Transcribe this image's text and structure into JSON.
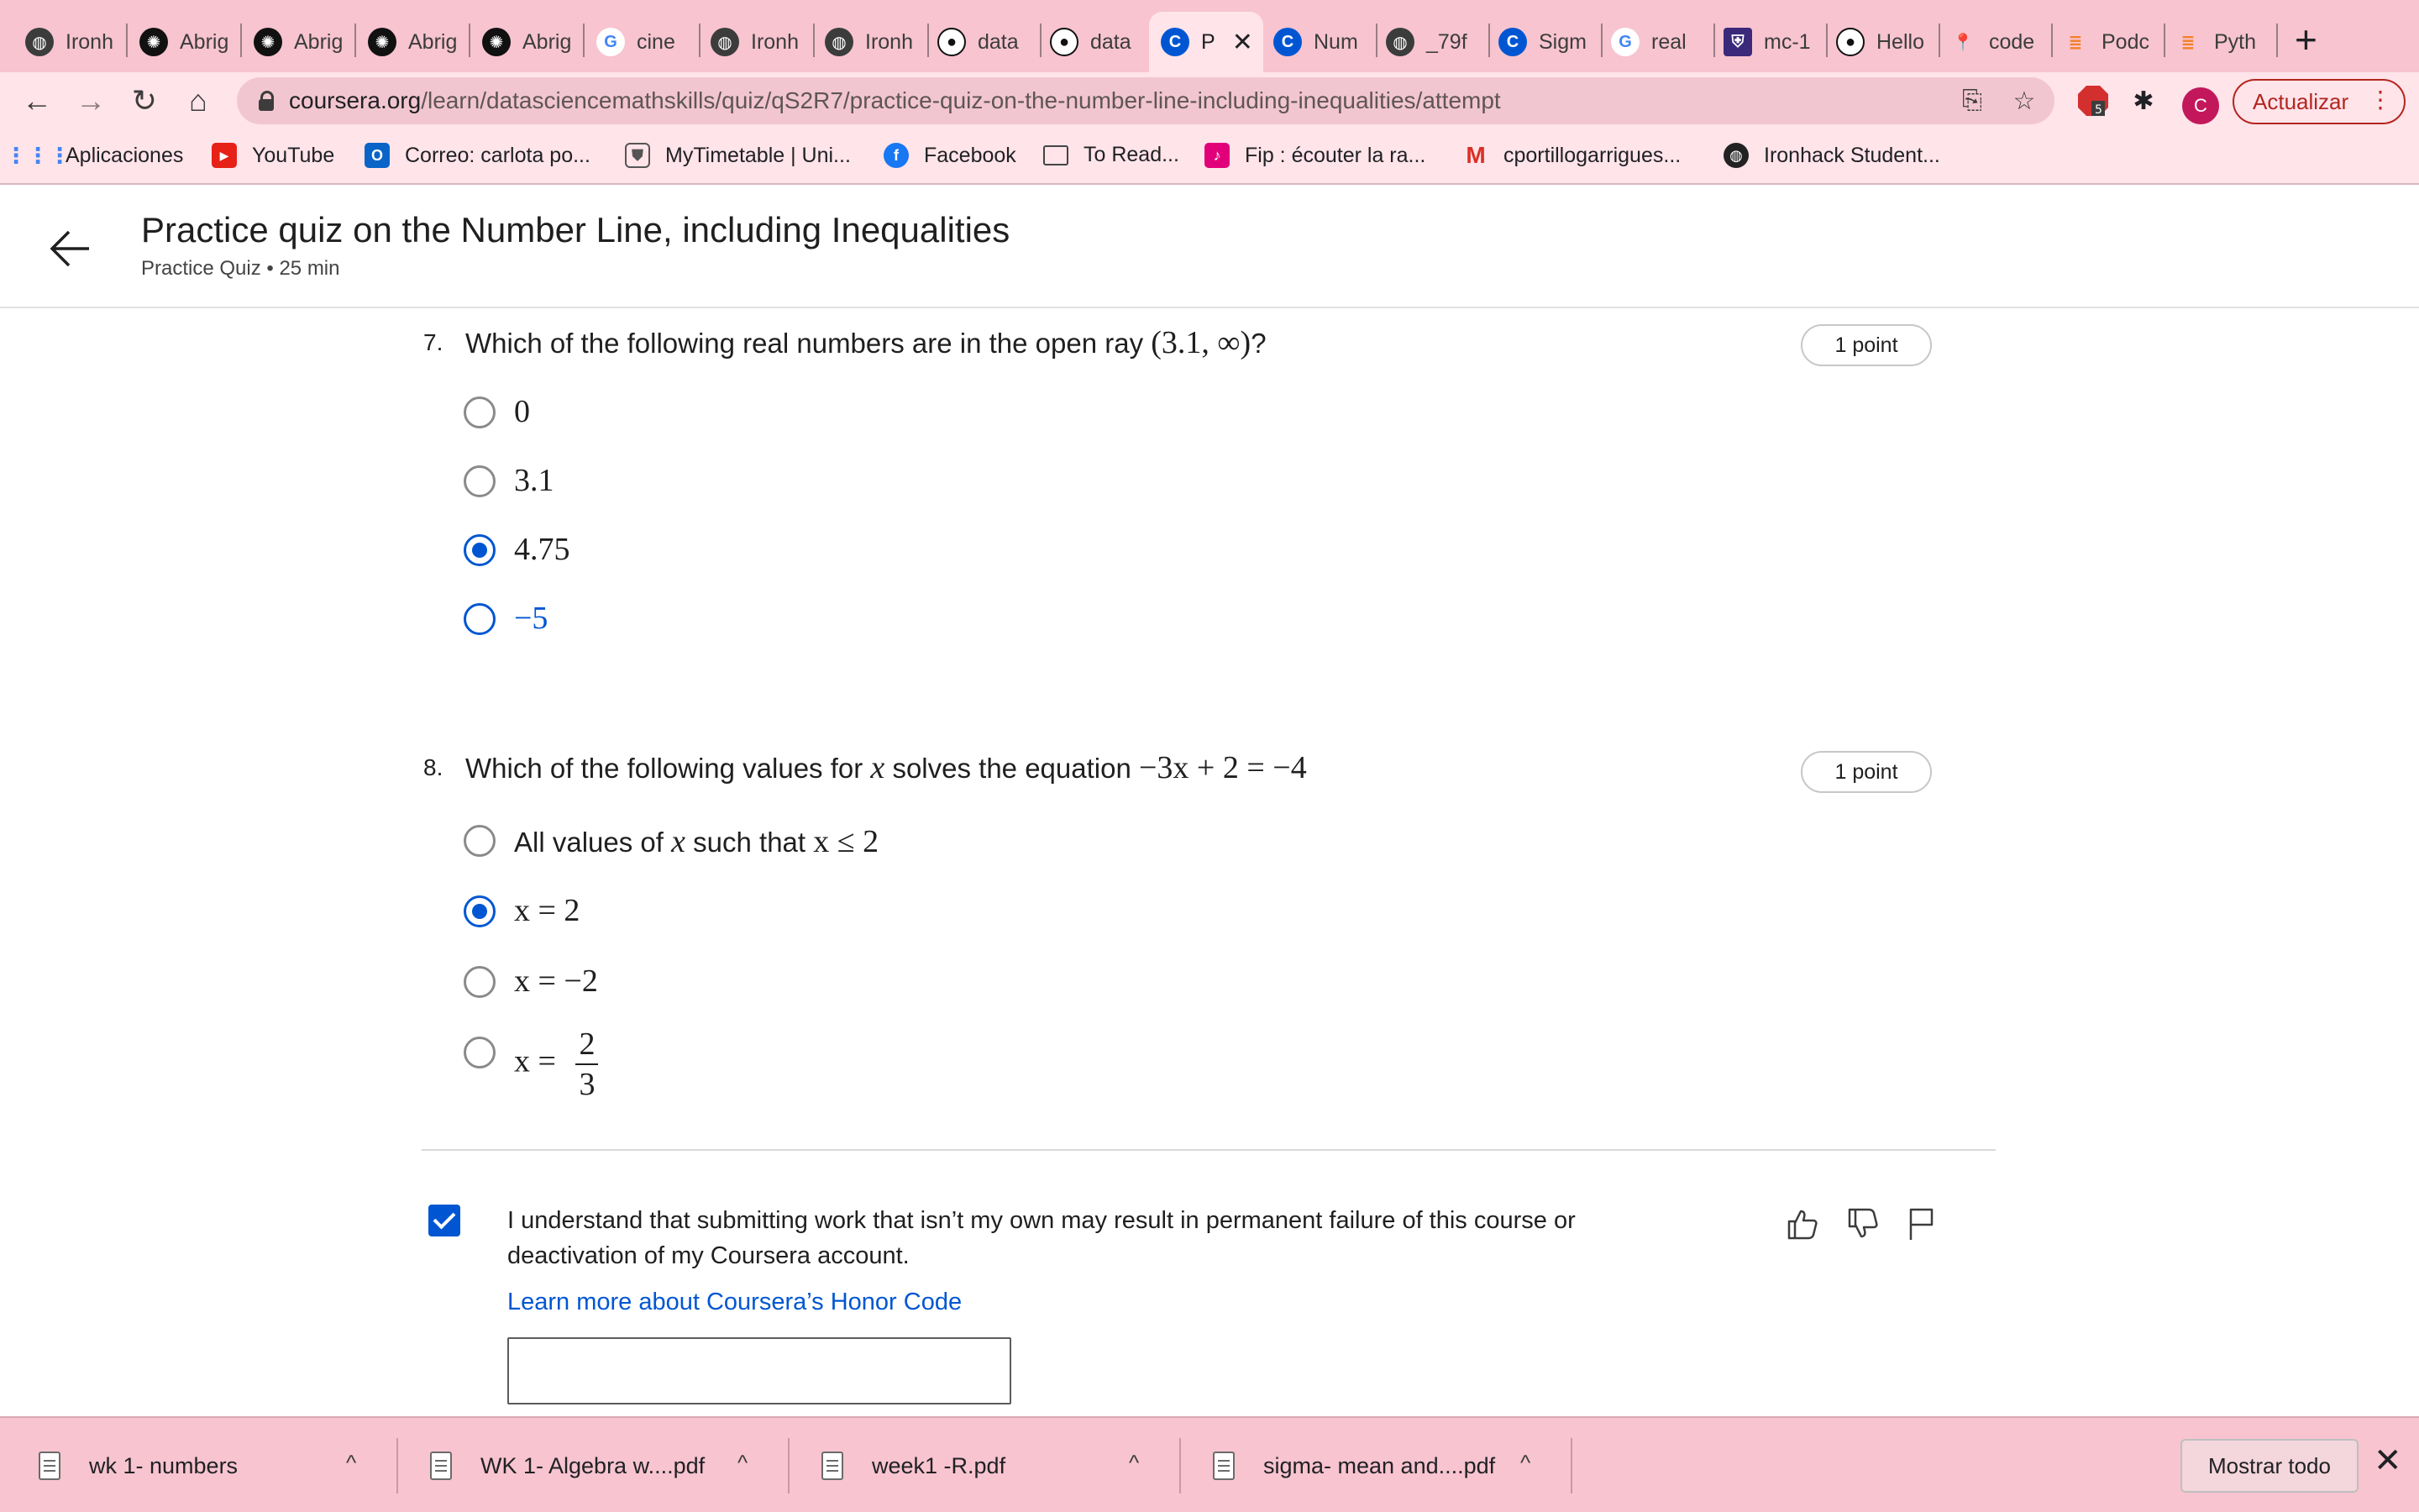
{
  "browser": {
    "tabs": [
      {
        "label": "Ironh",
        "icon": "globe-icon"
      },
      {
        "label": "Abrig",
        "icon": "openai-icon"
      },
      {
        "label": "Abrig",
        "icon": "openai-icon"
      },
      {
        "label": "Abrig",
        "icon": "openai-icon"
      },
      {
        "label": "Abrig",
        "icon": "openai-icon"
      },
      {
        "label": "cine",
        "icon": "google-icon"
      },
      {
        "label": "Ironh",
        "icon": "globe-icon"
      },
      {
        "label": "Ironh",
        "icon": "globe-icon"
      },
      {
        "label": "data",
        "icon": "github-icon"
      },
      {
        "label": "data",
        "icon": "github-icon"
      },
      {
        "label": "P",
        "icon": "coursera-icon",
        "active": true
      },
      {
        "label": "Num",
        "icon": "coursera-icon"
      },
      {
        "label": "_79f",
        "icon": "globe-icon"
      },
      {
        "label": "Sigm",
        "icon": "coursera-icon"
      },
      {
        "label": "real",
        "icon": "google-icon"
      },
      {
        "label": "mc-1",
        "icon": "shield-icon"
      },
      {
        "label": "Hello",
        "icon": "github-icon"
      },
      {
        "label": "code",
        "icon": "pin-icon"
      },
      {
        "label": "Podc",
        "icon": "stack-icon"
      },
      {
        "label": "Pyth",
        "icon": "stack-icon"
      }
    ],
    "url_host": "coursera.org",
    "url_path": "/learn/datasciencemathskills/quiz/qS2R7/practice-quiz-on-the-number-line-including-inequalities/attempt",
    "extension_badge": "5",
    "avatar_letter": "C",
    "update_label": "Actualizar",
    "bookmarks": [
      {
        "label": "Aplicaciones",
        "icon": "apps-grid-icon"
      },
      {
        "label": "YouTube",
        "icon": "youtube-icon"
      },
      {
        "label": "Correo: carlota po...",
        "icon": "outlook-icon"
      },
      {
        "label": "MyTimetable | Uni...",
        "icon": "crest-icon"
      },
      {
        "label": "Facebook",
        "icon": "facebook-icon"
      },
      {
        "label": "To Read...",
        "icon": "folder-icon"
      },
      {
        "label": "Fip : écouter la ra...",
        "icon": "fip-icon"
      },
      {
        "label": "cportillogarrigues...",
        "icon": "gmail-icon"
      },
      {
        "label": "Ironhack Student...",
        "icon": "globe-icon"
      }
    ]
  },
  "page": {
    "title": "Practice quiz on the Number Line, including Inequalities",
    "subtitle": "Practice Quiz • 25 min"
  },
  "questions": [
    {
      "number": "7.",
      "text": "Which of the following real numbers are in the open ray",
      "math": "(3.1, ∞)",
      "suffix": "?",
      "points": "1 point",
      "options": [
        "0",
        "3.1",
        "4.75",
        "−5"
      ],
      "selected_index": 2
    },
    {
      "number": "8.",
      "text_a": "Which of the following values for",
      "var": "x",
      "text_b": "solves the equation",
      "math": "−3x + 2 = −4",
      "points": "1 point",
      "options": [
        {
          "pre": "All values of",
          "var": "x",
          "mid": "such that",
          "math": "x ≤ 2"
        },
        {
          "math": "x = 2"
        },
        {
          "math": "x = −2"
        },
        {
          "math": "x =",
          "num": "2",
          "den": "3"
        }
      ],
      "selected_index": 1
    }
  ],
  "honor": {
    "checked": true,
    "text": "I understand that submitting work that isn’t my own may result in permanent failure of this course or deactivation of my Coursera account.",
    "link": "Learn more about Coursera’s Honor Code",
    "name_value": ""
  },
  "downloads": {
    "items": [
      "wk 1- numbers",
      "WK 1- Algebra w....pdf",
      "week1 -R.pdf",
      "sigma- mean and....pdf"
    ],
    "show_all": "Mostrar todo"
  }
}
